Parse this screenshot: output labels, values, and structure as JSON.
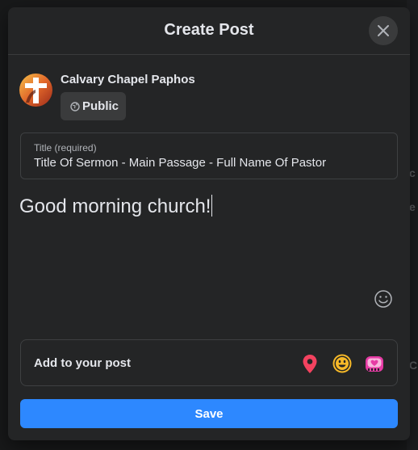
{
  "modal": {
    "title": "Create Post"
  },
  "author": {
    "name": "Calvary Chapel Paphos",
    "audience_label": "Public"
  },
  "title_field": {
    "label": "Title (required)",
    "value": "Title Of Sermon - Main Passage - Full Name Of Pastor"
  },
  "post_body": {
    "text": "Good morning church!"
  },
  "add_to_post": {
    "label": "Add to your post",
    "icons": [
      "location-icon",
      "feeling-icon",
      "fundraiser-icon"
    ]
  },
  "actions": {
    "save_label": "Save"
  },
  "colors": {
    "background": "#242526",
    "accent": "#2d88ff",
    "text": "#e4e6eb",
    "location": "#f3425f",
    "feeling": "#f7b928",
    "fundraiser": "#e63ba5"
  }
}
